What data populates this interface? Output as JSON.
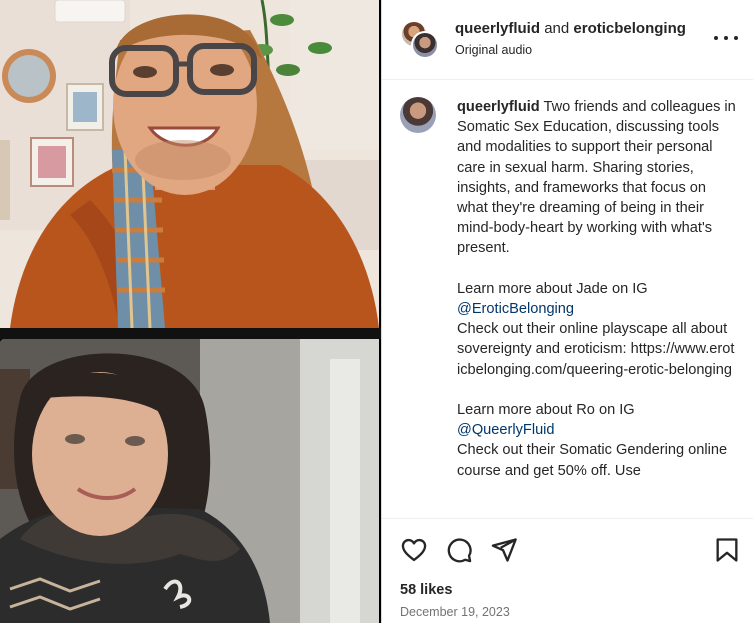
{
  "header": {
    "user1": "queerlyfluid",
    "joiner": "and",
    "user2": "eroticbelonging",
    "subtitle": "Original audio",
    "more_icon": "more-horizontal-icon"
  },
  "caption": {
    "username": "queerlyfluid",
    "p1": "Two friends and colleagues in Somatic Sex Education, discussing tools and modalities to support their personal care in sexual harm. Sharing stories, insights, and frameworks that focus on what they're dreaming of being in their mind-body-heart by working with what's present.",
    "p2": "Learn more about Jade on IG",
    "link1": "@EroticBelonging",
    "p3": "Check out their online playscape all about sovereignty and eroticism: https://www.eroticbelonging.com/queering-erotic-belonging",
    "p4": "Learn more about Ro on IG",
    "link2": "@QueerlyFluid",
    "p5": "Check out their Somatic Gendering online course and get 50% off. Use"
  },
  "actions": {
    "like_icon": "heart-icon",
    "comment_icon": "comment-icon",
    "share_icon": "send-icon",
    "save_icon": "bookmark-icon"
  },
  "stats": {
    "likes": "58 likes",
    "date": "December 19, 2023"
  },
  "colors": {
    "link": "#00376b",
    "text": "#262626",
    "muted": "#737373"
  }
}
